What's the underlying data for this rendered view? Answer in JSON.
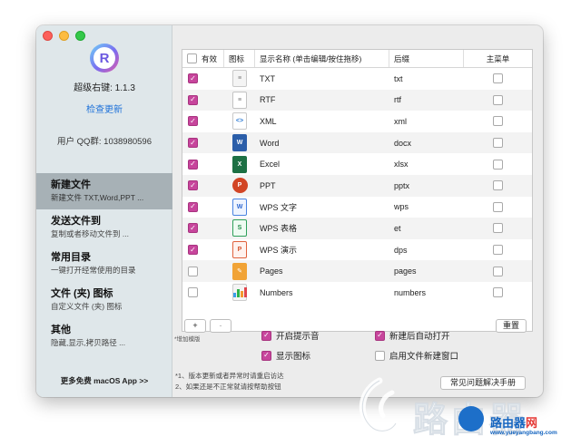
{
  "sidebar": {
    "app_version": "超级右键: 1.1.3",
    "check_update": "检查更新",
    "qq_group": "用户 QQ群: 1038980596",
    "logo_letter": "R",
    "items": [
      {
        "title": "新建文件",
        "desc": "新建文件 TXT,Word,PPT ...",
        "active": true
      },
      {
        "title": "发送文件到",
        "desc": "复制或者移动文件到 ..."
      },
      {
        "title": "常用目录",
        "desc": "一键打开经常使用的目录"
      },
      {
        "title": "文件 (夹) 图标",
        "desc": "自定义文件 (夹) 图标"
      },
      {
        "title": "其他",
        "desc": "隐藏,显示,拷贝路径 ..."
      }
    ],
    "more_apps": "更多免费 macOS App >>"
  },
  "table": {
    "headers": {
      "valid": "有效",
      "icon": "图标",
      "name": "显示名称 (单击编辑/按住拖移)",
      "ext": "后缀",
      "menu": "主菜单"
    },
    "rows": [
      {
        "valid": true,
        "icon": "txt-file-icon",
        "name": "TXT",
        "ext": "txt",
        "menu": false
      },
      {
        "valid": true,
        "icon": "rtf-file-icon",
        "name": "RTF",
        "ext": "rtf",
        "menu": false
      },
      {
        "valid": true,
        "icon": "xml-file-icon",
        "name": "XML",
        "ext": "xml",
        "menu": false
      },
      {
        "valid": true,
        "icon": "word-icon",
        "name": "Word",
        "ext": "docx",
        "menu": false
      },
      {
        "valid": true,
        "icon": "excel-icon",
        "name": "Excel",
        "ext": "xlsx",
        "menu": false
      },
      {
        "valid": true,
        "icon": "powerpoint-icon",
        "name": "PPT",
        "ext": "pptx",
        "menu": false
      },
      {
        "valid": true,
        "icon": "wps-writer-icon",
        "name": "WPS 文字",
        "ext": "wps",
        "menu": false
      },
      {
        "valid": true,
        "icon": "wps-spreadsheet-icon",
        "name": "WPS 表格",
        "ext": "et",
        "menu": false
      },
      {
        "valid": true,
        "icon": "wps-presentation-icon",
        "name": "WPS 演示",
        "ext": "dps",
        "menu": false
      },
      {
        "valid": false,
        "icon": "pages-icon",
        "name": "Pages",
        "ext": "pages",
        "menu": false
      },
      {
        "valid": false,
        "icon": "numbers-icon",
        "name": "Numbers",
        "ext": "numbers",
        "menu": false
      }
    ]
  },
  "controls": {
    "add": "+",
    "remove": "-",
    "add_note": "*增加模版",
    "reset": "重置",
    "options": {
      "sound": {
        "label": "开启提示音",
        "checked": true
      },
      "show_icons": {
        "label": "显示图标",
        "checked": true
      },
      "auto_open": {
        "label": "新建后自动打开",
        "checked": true
      },
      "new_window": {
        "label": "启用文件新建窗口",
        "checked": false
      }
    },
    "note1": "*1、版本更新或者异常时请重启访达",
    "note2": "2、如果还是不正常就请按帮助按钮",
    "faq": "常见问题解决手册"
  },
  "watermark": {
    "text": "路由器",
    "site_name_a": "路由器",
    "site_name_b": "网",
    "url": "www.yueyangbang.com"
  },
  "colors": {
    "accent_checkbox": "#c7459c",
    "link": "#1f72d9",
    "sidebar_active": "#a7b1b6"
  }
}
